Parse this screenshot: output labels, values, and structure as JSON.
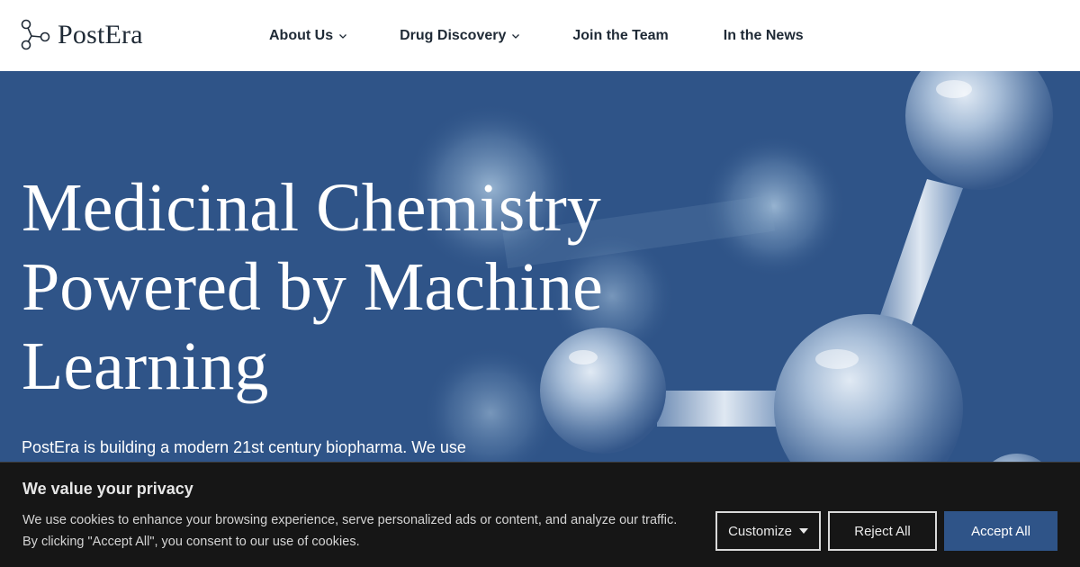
{
  "brand": {
    "name": "PostEra"
  },
  "nav": {
    "items": [
      {
        "label": "About Us",
        "has_dropdown": true
      },
      {
        "label": "Drug Discovery",
        "has_dropdown": true
      },
      {
        "label": "Join the Team",
        "has_dropdown": false
      },
      {
        "label": "In the News",
        "has_dropdown": false
      }
    ]
  },
  "hero": {
    "title_line1": "Medicinal Chemistry",
    "title_line2": "Powered by Machine",
    "title_line3": "Learning",
    "subtitle": "PostEra is building a modern 21st century biopharma. We use"
  },
  "cookie_banner": {
    "title": "We value your privacy",
    "text_line1": "We use cookies to enhance your browsing experience, serve personalized ads or content, and analyze our traffic.",
    "text_line2": "By clicking \"Accept All\", you consent to our use of cookies.",
    "customize_label": "Customize",
    "reject_label": "Reject All",
    "accept_label": "Accept All"
  },
  "colors": {
    "hero_bg": "#2f5488",
    "header_bg": "#ffffff",
    "banner_bg": "#161616",
    "accent": "#2f5488"
  },
  "icons": {
    "logo": "molecule-logo-icon",
    "dropdown": "chevron-down-icon",
    "customize_caret": "caret-down-icon",
    "hero_image": "molecule-illustration"
  }
}
